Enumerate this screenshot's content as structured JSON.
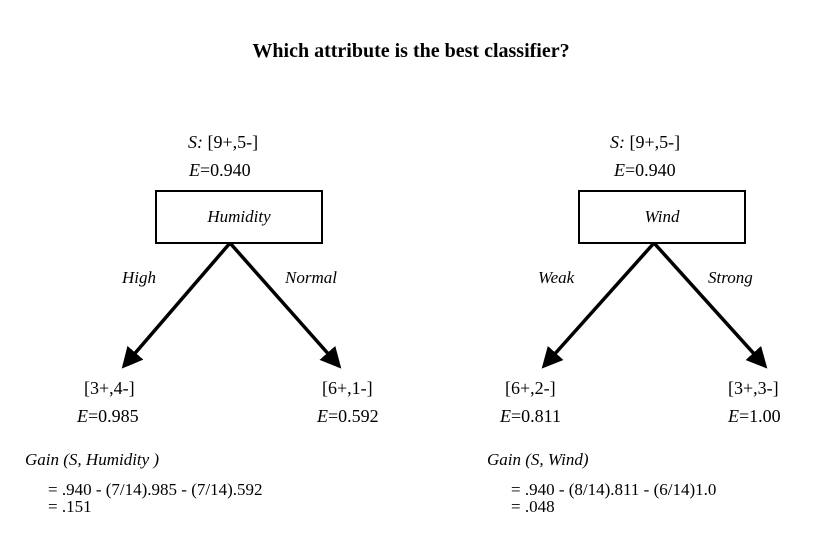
{
  "title": "Which attribute is the best classifier?",
  "trees": [
    {
      "root_s_label": "S:",
      "root_s_value": "[9+,5-]",
      "root_e_label": "E",
      "root_e_value": "=0.940",
      "attribute": "Humidity",
      "left_branch": "High",
      "right_branch": "Normal",
      "left_leaf": {
        "counts": "[3+,4-]",
        "e_label": "E",
        "e_value": "=0.985"
      },
      "right_leaf": {
        "counts": "[6+,1-]",
        "e_label": "E",
        "e_value": "=0.592"
      },
      "gain_label": "Gain (S,  Humidity  )",
      "gain_formula": "= .940 - (7/14).985 - (7/14).592",
      "gain_result": "= .151"
    },
    {
      "root_s_label": "S:",
      "root_s_value": "[9+,5-]",
      "root_e_label": "E",
      "root_e_value": "=0.940",
      "attribute": "Wind",
      "left_branch": "Weak",
      "right_branch": "Strong",
      "left_leaf": {
        "counts": "[6+,2-]",
        "e_label": "E",
        "e_value": "=0.811"
      },
      "right_leaf": {
        "counts": "[3+,3-]",
        "e_label": "E",
        "e_value": "=1.00"
      },
      "gain_label": "Gain (S, Wind)",
      "gain_formula": "= .940 - (8/14).811 - (6/14)1.0",
      "gain_result": "= .048"
    }
  ]
}
